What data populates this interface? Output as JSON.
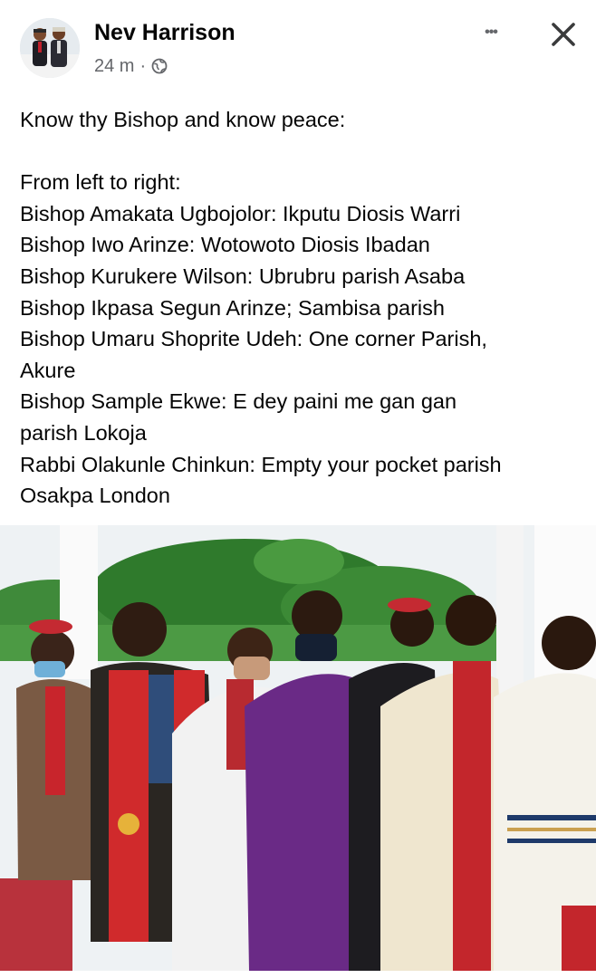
{
  "post": {
    "author_name": "Nev Harrison",
    "timestamp": "24 m",
    "separator": "·",
    "audience_icon": "globe-icon",
    "more_icon": "more-horizontal-icon",
    "more_label": "•••",
    "close_icon": "close-icon",
    "text_lines": [
      "Know thy Bishop and know peace:",
      "",
      "From left to right:",
      "Bishop Amakata Ugbojolor: Ikputu Diosis Warri",
      "Bishop Iwo Arinze: Wotowoto Diosis Ibadan",
      "Bishop Kurukere Wilson: Ubrubru parish Asaba",
      "Bishop Ikpasa Segun Arinze; Sambisa parish",
      "Bishop Umaru Shoprite Udeh: One corner Parish,",
      "Akure",
      "Bishop Sample Ekwe: E dey paini me gan gan",
      "parish Lokoja",
      "Rabbi Olakunle Chinkun: Empty your pocket parish",
      "Osakpa London"
    ]
  },
  "colors": {
    "text_primary": "#050505",
    "text_secondary": "#65676b",
    "background": "#ffffff"
  }
}
